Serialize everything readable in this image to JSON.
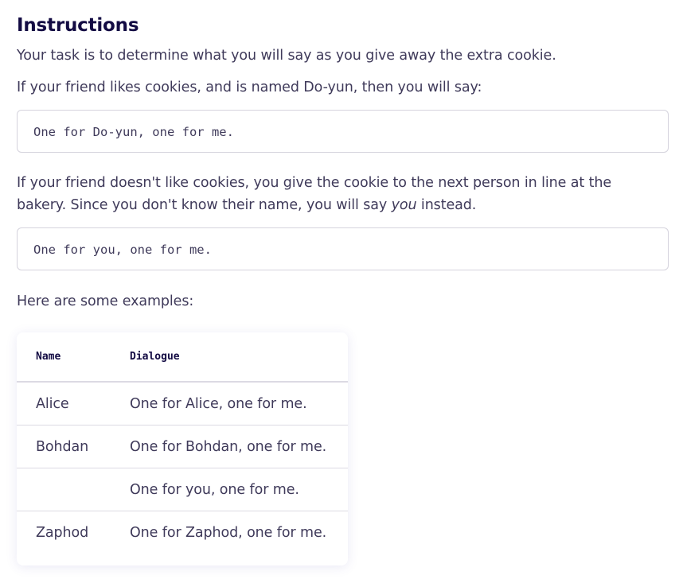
{
  "heading": "Instructions",
  "paragraphs": {
    "task": "Your task is to determine what you will say as you give away the extra cookie.",
    "friend_likes": "If your friend likes cookies, and is named Do-yun, then you will say:",
    "friend_dislikes_before": "If your friend doesn't like cookies, you give the cookie to the next person in line at the bakery. Since you don't know their name, you will say ",
    "friend_dislikes_em": "you",
    "friend_dislikes_after": " instead.",
    "examples_intro": "Here are some examples:"
  },
  "code_blocks": {
    "named": "One for Do-yun, one for me.",
    "unnamed": "One for you, one for me."
  },
  "table": {
    "headers": {
      "name": "Name",
      "dialogue": "Dialogue"
    },
    "rows": [
      {
        "name": "Alice",
        "dialogue": "One for Alice, one for me."
      },
      {
        "name": "Bohdan",
        "dialogue": "One for Bohdan, one for me."
      },
      {
        "name": "",
        "dialogue": "One for you, one for me."
      },
      {
        "name": "Zaphod",
        "dialogue": "One for Zaphod, one for me."
      }
    ]
  }
}
